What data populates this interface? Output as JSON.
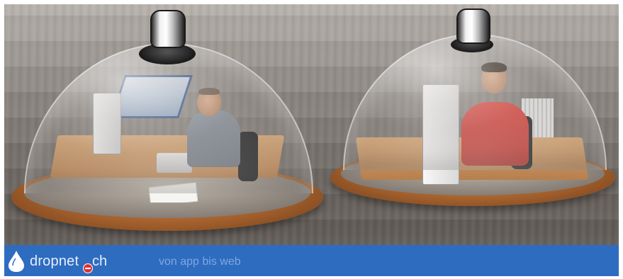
{
  "brand": {
    "name": "dropnet",
    "tld": "ch",
    "tagline": "von app bis web",
    "logo_icon": "water-drop-icon",
    "accent_dot_icon": "red-dot-icon",
    "colors": {
      "bar": "#2e6cc0",
      "text": "#e7eefb",
      "tagline": "#7fa8df",
      "dot": "#d93434"
    }
  },
  "hero": {
    "images": [
      {
        "name": "cloche-left",
        "scene": "office-desk-man-grey-shirt"
      },
      {
        "name": "cloche-right",
        "scene": "office-desk-man-red-shirt"
      }
    ]
  }
}
